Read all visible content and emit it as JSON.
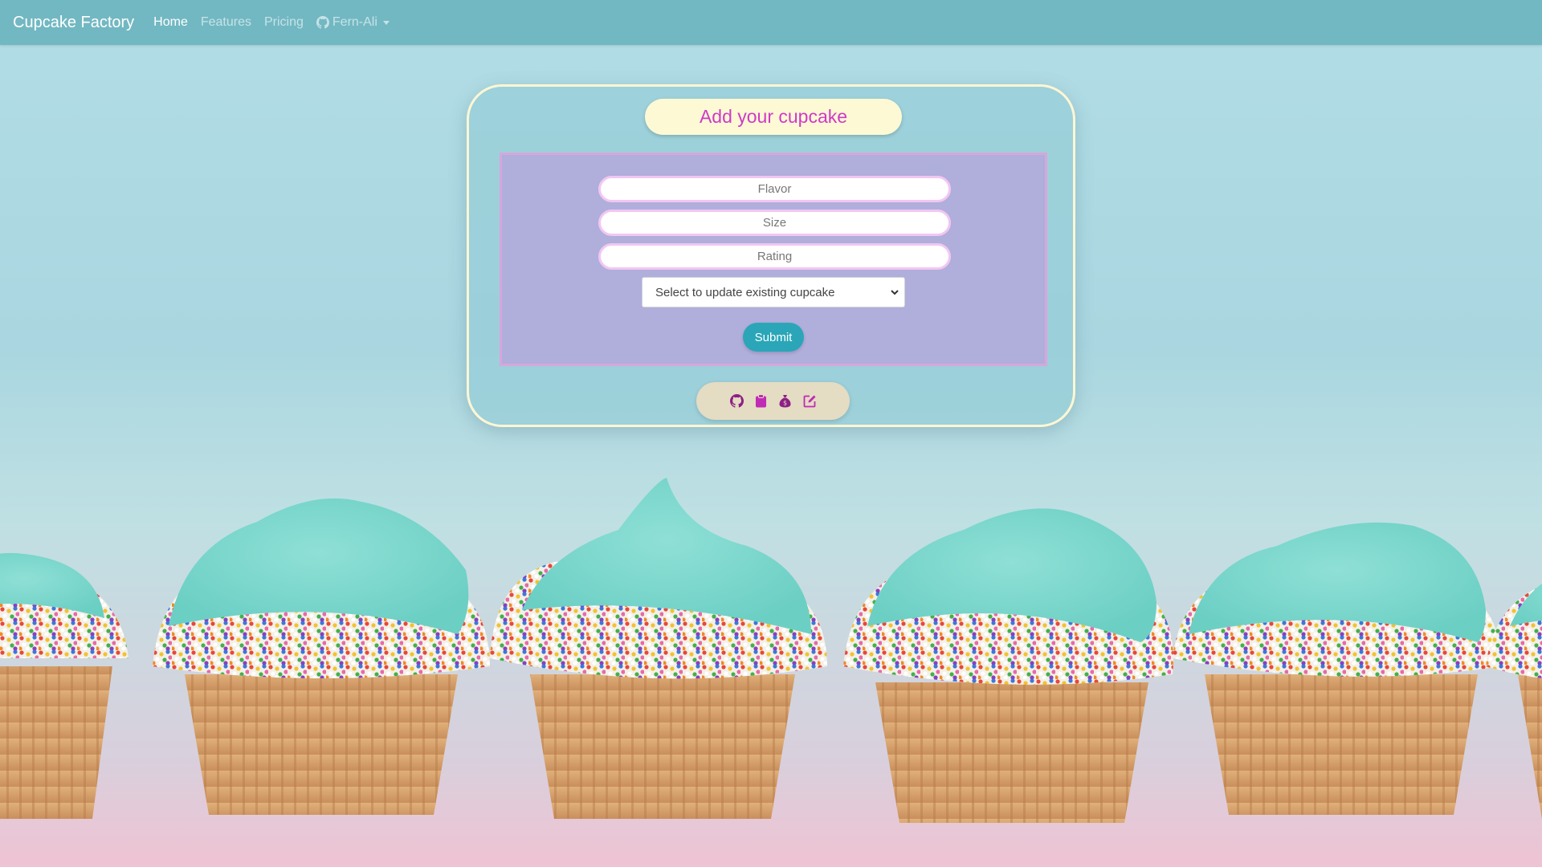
{
  "navbar": {
    "brand": "Cupcake Factory",
    "links": [
      {
        "label": "Home",
        "active": true
      },
      {
        "label": "Features",
        "active": false
      },
      {
        "label": "Pricing",
        "active": false
      }
    ],
    "dropdown": {
      "label": "Fern-Ali",
      "icon": "github-icon"
    }
  },
  "card": {
    "title": "Add your cupcake",
    "form": {
      "flavor_placeholder": "Flavor",
      "size_placeholder": "Size",
      "rating_placeholder": "Rating",
      "select_value": "Select to update existing cupcake",
      "submit_label": "Submit"
    },
    "icon_bar": [
      "github-icon",
      "clipboard-icon",
      "money-bag-icon",
      "edit-icon"
    ]
  },
  "colors": {
    "navbar": "#72b8c2",
    "title_text": "#d03ac8",
    "title_pill": "#fcf9d4",
    "form_box": "#b0aedb",
    "submit_button": "#2aa6b8",
    "icon_color": "#c02bb5"
  }
}
